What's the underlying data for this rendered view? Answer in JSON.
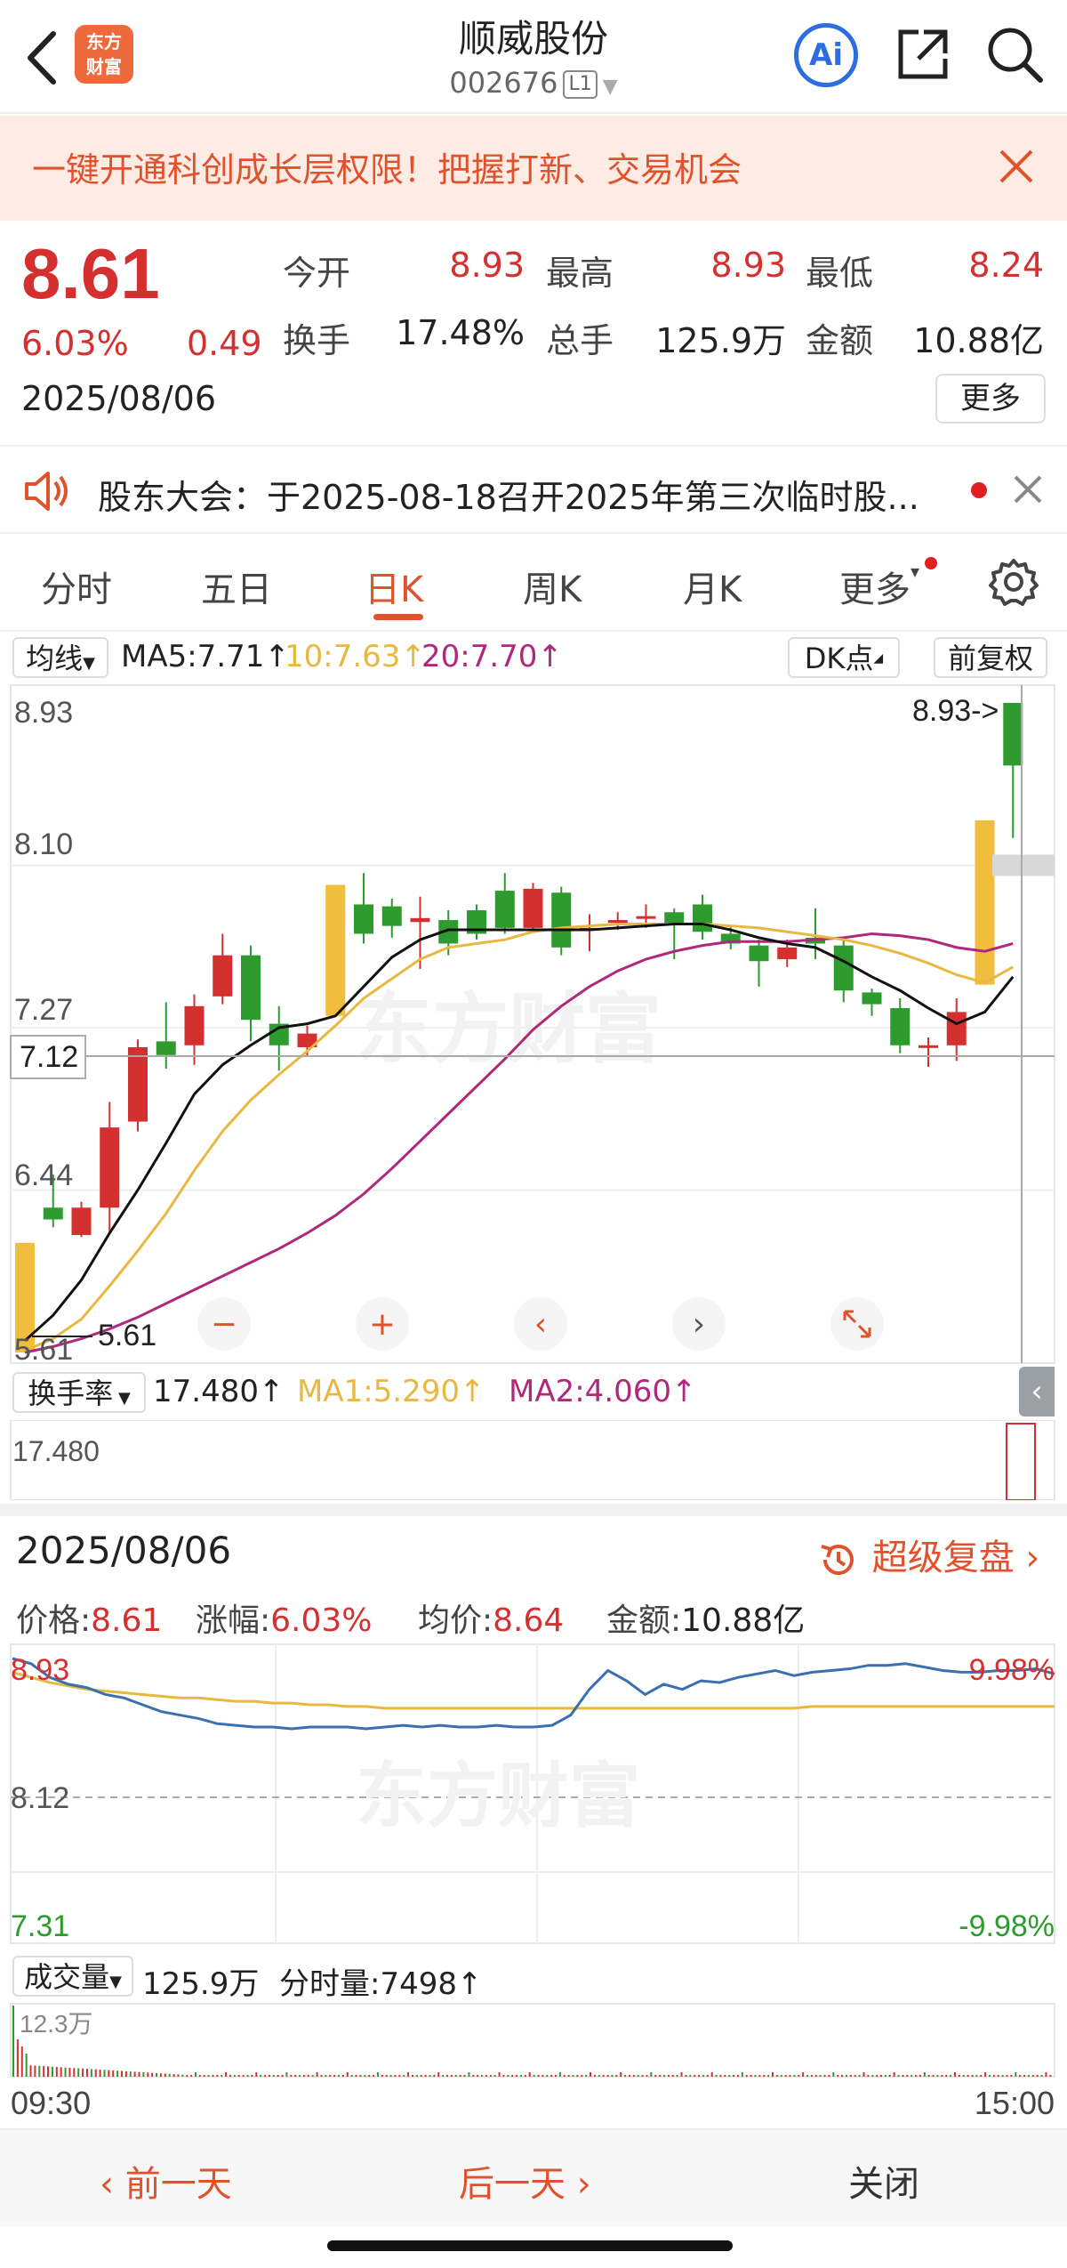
{
  "header": {
    "logo_line1": "东方",
    "logo_line2": "财富",
    "title": "顺威股份",
    "code": "002676",
    "level": "L1",
    "ai_label": "Ai"
  },
  "promo": {
    "text": "一键开通科创成长层权限！把握打新、交易机会"
  },
  "quote": {
    "price": "8.61",
    "change_pct": "6.03%",
    "change": "0.49",
    "date": "2025/08/06",
    "open_label": "今开",
    "open": "8.93",
    "high_label": "最高",
    "high": "8.93",
    "low_label": "最低",
    "low": "8.24",
    "turnover_label": "换手",
    "turnover": "17.48%",
    "volume_label": "总手",
    "volume": "125.9万",
    "amount_label": "金额",
    "amount": "10.88亿",
    "more_label": "更多"
  },
  "notice": {
    "text": "股东大会：于2025-08-18召开2025年第三次临时股..."
  },
  "tabs": [
    {
      "label": "分时"
    },
    {
      "label": "五日"
    },
    {
      "label": "日K"
    },
    {
      "label": "周K"
    },
    {
      "label": "月K"
    },
    {
      "label": "更多"
    }
  ],
  "ma_row": {
    "selector": "均线",
    "ma5": "MA5:7.71",
    "ma10": "10:7.63",
    "ma20": "20:7.70",
    "dk": "DK点",
    "adjust": "前复权"
  },
  "kline": {
    "y_top": "8.93",
    "y_2": "8.10",
    "y_3": "7.27",
    "y_4": "6.44",
    "y_bottom": "5.61",
    "crosshair_price": "7.12",
    "high_marker": "8.93->",
    "low_marker": "5.61",
    "colors": {
      "up": "#d43030",
      "down": "#2e9b2e",
      "limit": "#f0bd3c",
      "ma5": "#111111",
      "ma10": "#e8b840",
      "ma20": "#b0287c"
    },
    "candles": [
      {
        "o": 5.61,
        "c": 6.17,
        "h": 6.17,
        "l": 5.61,
        "t": "limit"
      },
      {
        "o": 6.35,
        "c": 6.29,
        "h": 6.52,
        "l": 6.25,
        "t": "down"
      },
      {
        "o": 6.21,
        "c": 6.35,
        "h": 6.38,
        "l": 6.2,
        "t": "up"
      },
      {
        "o": 6.35,
        "c": 6.76,
        "h": 6.89,
        "l": 6.22,
        "t": "up"
      },
      {
        "o": 6.79,
        "c": 7.17,
        "h": 7.21,
        "l": 6.74,
        "t": "up"
      },
      {
        "o": 7.2,
        "c": 7.13,
        "h": 7.4,
        "l": 7.06,
        "t": "down"
      },
      {
        "o": 7.18,
        "c": 7.38,
        "h": 7.44,
        "l": 7.08,
        "t": "up"
      },
      {
        "o": 7.43,
        "c": 7.64,
        "h": 7.75,
        "l": 7.39,
        "t": "up"
      },
      {
        "o": 7.64,
        "c": 7.31,
        "h": 7.69,
        "l": 7.2,
        "t": "down"
      },
      {
        "o": 7.29,
        "c": 7.18,
        "h": 7.38,
        "l": 7.05,
        "t": "down"
      },
      {
        "o": 7.17,
        "c": 7.24,
        "h": 7.28,
        "l": 7.12,
        "t": "up"
      },
      {
        "o": 7.33,
        "c": 8.0,
        "h": 8.0,
        "l": 7.33,
        "t": "limit"
      },
      {
        "o": 7.9,
        "c": 7.75,
        "h": 8.06,
        "l": 7.7,
        "t": "down"
      },
      {
        "o": 7.89,
        "c": 7.79,
        "h": 7.93,
        "l": 7.73,
        "t": "down"
      },
      {
        "o": 7.81,
        "c": 7.83,
        "h": 7.94,
        "l": 7.57,
        "t": "cross"
      },
      {
        "o": 7.82,
        "c": 7.7,
        "h": 7.87,
        "l": 7.64,
        "t": "down"
      },
      {
        "o": 7.87,
        "c": 7.75,
        "h": 7.9,
        "l": 7.72,
        "t": "down"
      },
      {
        "o": 7.97,
        "c": 7.78,
        "h": 8.06,
        "l": 7.75,
        "t": "down"
      },
      {
        "o": 7.78,
        "c": 7.98,
        "h": 8.01,
        "l": 7.76,
        "t": "up"
      },
      {
        "o": 7.96,
        "c": 7.68,
        "h": 7.99,
        "l": 7.64,
        "t": "down"
      },
      {
        "o": 7.77,
        "c": 7.78,
        "h": 7.85,
        "l": 7.66,
        "t": "cross"
      },
      {
        "o": 7.81,
        "c": 7.82,
        "h": 7.86,
        "l": 7.77,
        "t": "cross"
      },
      {
        "o": 7.84,
        "c": 7.83,
        "h": 7.9,
        "l": 7.78,
        "t": "cross"
      },
      {
        "o": 7.86,
        "c": 7.8,
        "h": 7.88,
        "l": 7.62,
        "t": "down"
      },
      {
        "o": 7.9,
        "c": 7.76,
        "h": 7.95,
        "l": 7.72,
        "t": "down"
      },
      {
        "o": 7.75,
        "c": 7.7,
        "h": 7.79,
        "l": 7.67,
        "t": "down"
      },
      {
        "o": 7.69,
        "c": 7.61,
        "h": 7.72,
        "l": 7.48,
        "t": "down"
      },
      {
        "o": 7.62,
        "c": 7.68,
        "h": 7.72,
        "l": 7.58,
        "t": "up"
      },
      {
        "o": 7.73,
        "c": 7.7,
        "h": 7.88,
        "l": 7.62,
        "t": "down"
      },
      {
        "o": 7.69,
        "c": 7.46,
        "h": 7.72,
        "l": 7.4,
        "t": "down"
      },
      {
        "o": 7.45,
        "c": 7.39,
        "h": 7.47,
        "l": 7.33,
        "t": "down"
      },
      {
        "o": 7.37,
        "c": 7.18,
        "h": 7.42,
        "l": 7.14,
        "t": "down"
      },
      {
        "o": 7.18,
        "c": 7.17,
        "h": 7.22,
        "l": 7.07,
        "t": "cross"
      },
      {
        "o": 7.18,
        "c": 7.35,
        "h": 7.42,
        "l": 7.1,
        "t": "up"
      },
      {
        "o": 7.49,
        "c": 8.33,
        "h": 8.33,
        "l": 7.49,
        "t": "limit"
      },
      {
        "o": 8.93,
        "c": 8.61,
        "h": 8.93,
        "l": 8.24,
        "t": "down"
      }
    ],
    "ma5": [
      5.67,
      5.8,
      5.98,
      6.22,
      6.44,
      6.68,
      6.93,
      7.08,
      7.18,
      7.27,
      7.29,
      7.33,
      7.48,
      7.63,
      7.72,
      7.77,
      7.77,
      7.77,
      7.77,
      7.77,
      7.77,
      7.78,
      7.79,
      7.8,
      7.8,
      7.77,
      7.73,
      7.7,
      7.68,
      7.61,
      7.53,
      7.46,
      7.37,
      7.29,
      7.35,
      7.53
    ],
    "ma10": [
      5.62,
      5.68,
      5.78,
      5.95,
      6.13,
      6.32,
      6.54,
      6.74,
      6.9,
      7.03,
      7.15,
      7.28,
      7.42,
      7.52,
      7.62,
      7.68,
      7.7,
      7.72,
      7.76,
      7.78,
      7.79,
      7.8,
      7.8,
      7.8,
      7.8,
      7.79,
      7.78,
      7.76,
      7.74,
      7.72,
      7.69,
      7.65,
      7.6,
      7.54,
      7.5,
      7.58
    ],
    "ma20": [
      5.61,
      5.64,
      5.68,
      5.73,
      5.79,
      5.86,
      5.93,
      6.0,
      6.07,
      6.14,
      6.22,
      6.31,
      6.42,
      6.55,
      6.69,
      6.83,
      6.97,
      7.11,
      7.26,
      7.38,
      7.48,
      7.56,
      7.62,
      7.66,
      7.69,
      7.71,
      7.71,
      7.71,
      7.72,
      7.73,
      7.75,
      7.74,
      7.72,
      7.68,
      7.66,
      7.7
    ]
  },
  "turnover_row": {
    "selector": "换手率",
    "value": "17.480",
    "ma1": "MA1:5.290",
    "ma2": "MA2:4.060",
    "axis": "17.480"
  },
  "detail": {
    "date": "2025/08/06",
    "replay": "超级复盘",
    "price_label": "价格:",
    "price": "8.61",
    "pct_label": "涨幅:",
    "pct": "6.03%",
    "avg_label": "均价:",
    "avg": "8.64",
    "amount_label": "金额:",
    "amount": "10.88亿"
  },
  "intraday": {
    "y_top": "8.93",
    "y_mid": "8.12",
    "y_bottom": "7.31",
    "pct_top": "9.98%",
    "pct_bottom": "-9.98%",
    "price_path": [
      8.93,
      8.9,
      8.82,
      8.78,
      8.76,
      8.72,
      8.7,
      8.66,
      8.62,
      8.6,
      8.58,
      8.55,
      8.54,
      8.53,
      8.53,
      8.52,
      8.53,
      8.53,
      8.53,
      8.52,
      8.53,
      8.54,
      8.53,
      8.54,
      8.53,
      8.53,
      8.54,
      8.53,
      8.53,
      8.54,
      8.6,
      8.75,
      8.86,
      8.8,
      8.72,
      8.78,
      8.75,
      8.8,
      8.79,
      8.82,
      8.84,
      8.86,
      8.83,
      8.85,
      8.86,
      8.87,
      8.89,
      8.89,
      8.9,
      8.88,
      8.86,
      8.85,
      8.85,
      8.86,
      8.86,
      8.87,
      8.84
    ],
    "avg_path": [
      8.85,
      8.82,
      8.79,
      8.77,
      8.75,
      8.74,
      8.73,
      8.72,
      8.71,
      8.7,
      8.7,
      8.69,
      8.68,
      8.68,
      8.67,
      8.67,
      8.66,
      8.66,
      8.65,
      8.65,
      8.64,
      8.64,
      8.64,
      8.64,
      8.64,
      8.64,
      8.64,
      8.64,
      8.64,
      8.64,
      8.64,
      8.64,
      8.64,
      8.64,
      8.64,
      8.64,
      8.64,
      8.64,
      8.64,
      8.64,
      8.64,
      8.64,
      8.64,
      8.65,
      8.65,
      8.65,
      8.65,
      8.65,
      8.65,
      8.65,
      8.65,
      8.65,
      8.65,
      8.65,
      8.65,
      8.65,
      8.65
    ]
  },
  "volume_row": {
    "selector": "成交量",
    "total": "125.9万",
    "minute": "分时量:7498",
    "axis": "12.3万",
    "time_start": "09:30",
    "time_end": "15:00"
  },
  "footer": {
    "prev": "前一天",
    "next": "后一天",
    "close": "关闭"
  }
}
